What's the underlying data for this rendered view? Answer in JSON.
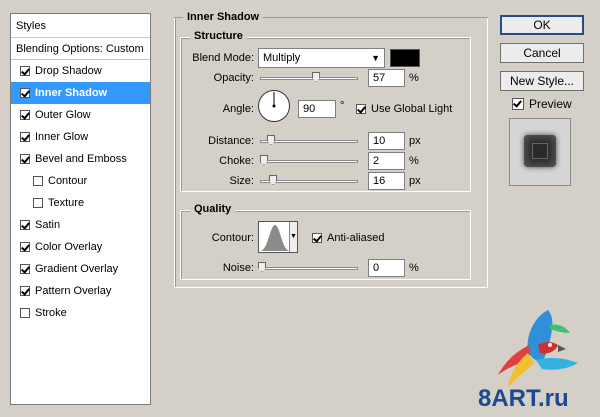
{
  "styles_panel": {
    "header": "Styles",
    "blending_options": "Blending Options: Custom",
    "items": [
      {
        "label": "Drop Shadow",
        "checked": true,
        "selected": false,
        "sub": false
      },
      {
        "label": "Inner Shadow",
        "checked": true,
        "selected": true,
        "sub": false
      },
      {
        "label": "Outer Glow",
        "checked": true,
        "selected": false,
        "sub": false
      },
      {
        "label": "Inner Glow",
        "checked": true,
        "selected": false,
        "sub": false
      },
      {
        "label": "Bevel and Emboss",
        "checked": true,
        "selected": false,
        "sub": false
      },
      {
        "label": "Contour",
        "checked": false,
        "selected": false,
        "sub": true
      },
      {
        "label": "Texture",
        "checked": false,
        "selected": false,
        "sub": true
      },
      {
        "label": "Satin",
        "checked": true,
        "selected": false,
        "sub": false
      },
      {
        "label": "Color Overlay",
        "checked": true,
        "selected": false,
        "sub": false
      },
      {
        "label": "Gradient Overlay",
        "checked": true,
        "selected": false,
        "sub": false
      },
      {
        "label": "Pattern Overlay",
        "checked": true,
        "selected": false,
        "sub": false
      },
      {
        "label": "Stroke",
        "checked": false,
        "selected": false,
        "sub": false
      }
    ]
  },
  "inner_shadow": {
    "title": "Inner Shadow",
    "structure_title": "Structure",
    "blend_mode_label": "Blend Mode:",
    "blend_mode_value": "Multiply",
    "shadow_color": "#000000",
    "opacity_label": "Opacity:",
    "opacity_value": "57",
    "opacity_unit": "%",
    "opacity_fraction": 0.57,
    "angle_label": "Angle:",
    "angle_value": "90",
    "angle_unit": "°",
    "use_global_light_label": "Use Global Light",
    "use_global_light": true,
    "distance_label": "Distance:",
    "distance_value": "10",
    "distance_unit": "px",
    "choke_label": "Choke:",
    "choke_value": "2",
    "choke_unit": "%",
    "size_label": "Size:",
    "size_value": "16",
    "size_unit": "px",
    "quality_title": "Quality",
    "contour_label": "Contour:",
    "anti_aliased_label": "Anti-aliased",
    "anti_aliased": true,
    "noise_label": "Noise:",
    "noise_value": "0",
    "noise_unit": "%"
  },
  "buttons": {
    "ok": "OK",
    "cancel": "Cancel",
    "new_style": "New Style...",
    "preview_label": "Preview",
    "preview_checked": true
  },
  "watermark": {
    "text": "8ART.ru"
  },
  "colors": {
    "selection": "#3399ff",
    "dialog_bg": "#d4d0c8"
  }
}
